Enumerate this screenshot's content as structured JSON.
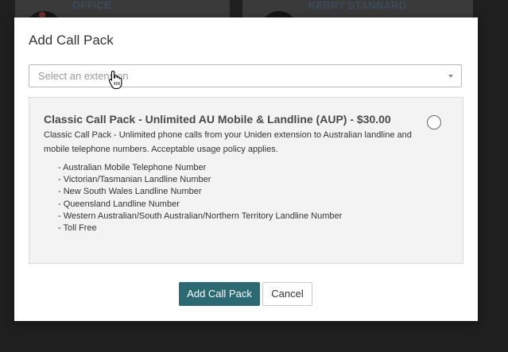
{
  "background": {
    "cards": [
      {
        "name": "OFFICE"
      },
      {
        "name": "KERRY STANNARD"
      }
    ]
  },
  "modal": {
    "title": "Add Call Pack",
    "extension_select": {
      "placeholder": "Select an extension"
    },
    "pack": {
      "title": "Classic Call Pack - Unlimited AU Mobile & Landline (AUP) - $30.00",
      "description": "Classic Call Pack - Unlimited phone calls from your Uniden extension to Australian landline and mobile telephone numbers. Acceptable usage policy applies.",
      "features": [
        "- Australian Mobile Telephone Number",
        "- Victorian/Tasmanian Landline Number",
        "- New South Wales Landline Number",
        "- Queensland Landline Number",
        "- Western Australian/South Australian/Northern Territory Landline Number",
        "- Toll Free"
      ],
      "selected": false
    },
    "buttons": {
      "submit_label": "Add Call Pack",
      "cancel_label": "Cancel"
    }
  },
  "colors": {
    "primary_button": "#2c6a73",
    "overlay": "#1f1f1f"
  },
  "icons": {
    "cursor": "hand-pointer-icon",
    "dropdown": "chevron-down-icon"
  }
}
